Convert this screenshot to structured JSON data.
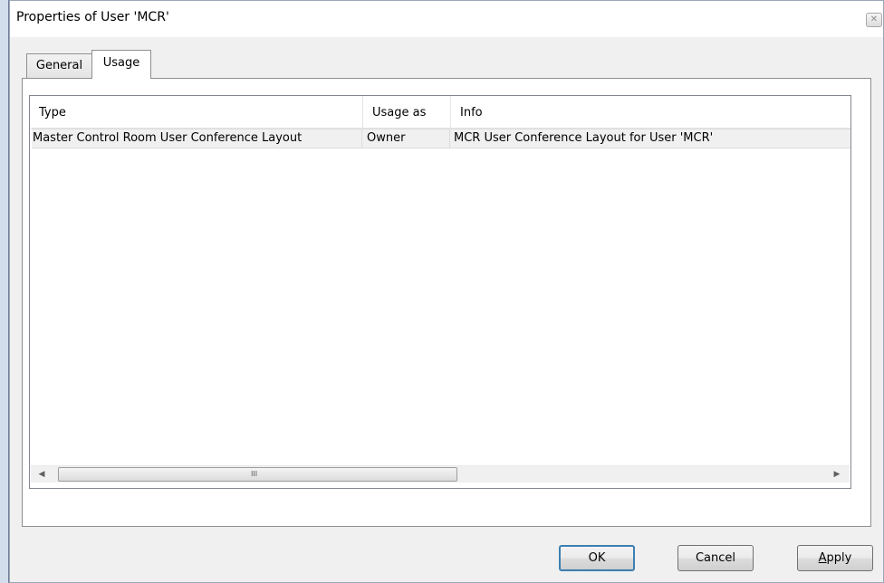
{
  "window": {
    "title": "Properties of User 'MCR'",
    "close_icon": "close-icon"
  },
  "tabs": [
    {
      "label": "General",
      "active": false
    },
    {
      "label": "Usage",
      "active": true
    }
  ],
  "usage_table": {
    "columns": [
      "Type",
      "Usage as",
      "Info"
    ],
    "rows": [
      {
        "type": "Master Control Room User Conference Layout",
        "usage_as": "Owner",
        "info": "MCR User Conference Layout for User 'MCR'"
      }
    ],
    "scrollbar_grip": "III"
  },
  "buttons": {
    "ok": "OK",
    "cancel": "Cancel",
    "apply_first": "A",
    "apply_rest": "pply"
  }
}
